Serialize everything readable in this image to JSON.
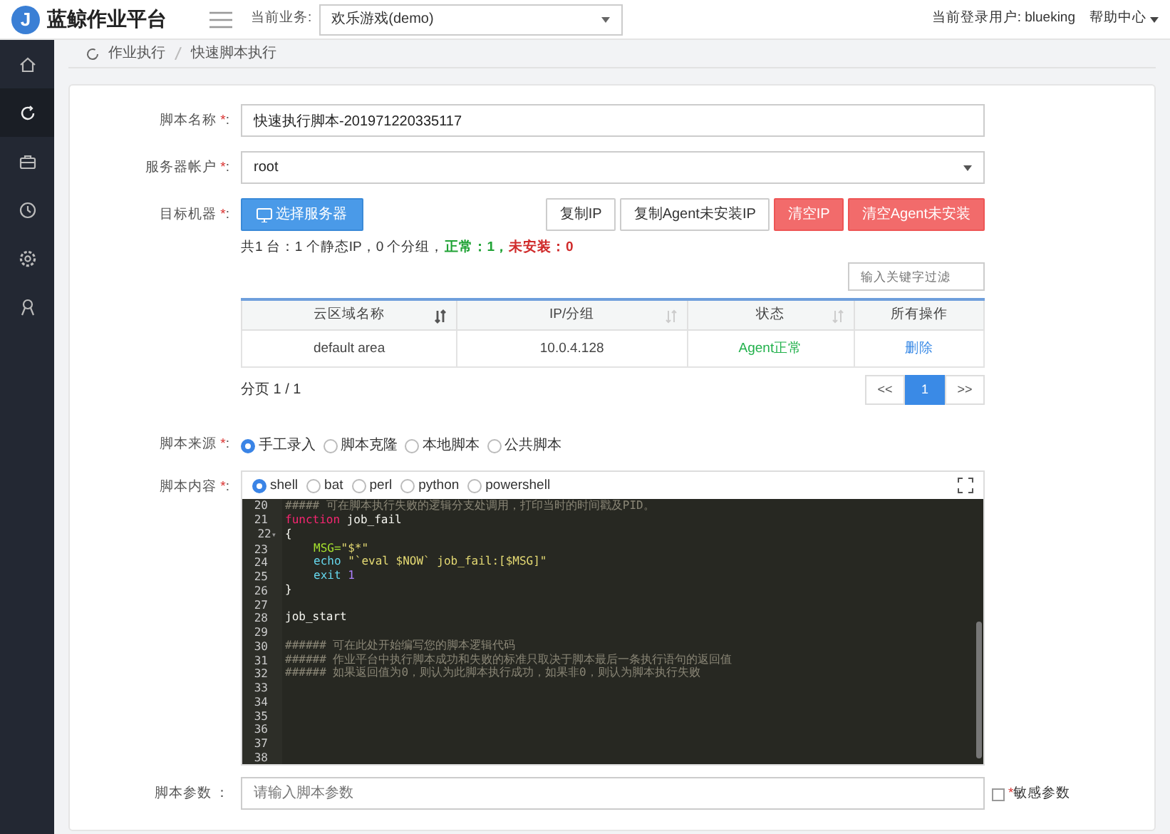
{
  "header": {
    "logo_letter": "J",
    "title": "蓝鲸作业平台",
    "business_label": "当前业务:",
    "business_value": "欢乐游戏(demo)",
    "user": "当前登录用户: blueking",
    "help": "帮助中心"
  },
  "sidebar": {
    "items": [
      {
        "kind": "home",
        "selected": false
      },
      {
        "kind": "refresh",
        "selected": true
      },
      {
        "kind": "briefcase",
        "selected": false
      },
      {
        "kind": "clock",
        "selected": false
      },
      {
        "kind": "gear",
        "selected": false
      },
      {
        "kind": "award",
        "selected": false
      }
    ]
  },
  "breadcrumb": [
    "作业执行",
    "快速脚本执行"
  ],
  "script_name": {
    "label": "脚本名称",
    "mark": "*",
    "suffix": ":",
    "value": "快速执行脚本-201971220335117"
  },
  "account": {
    "label": "服务器帐户",
    "mark": "*",
    "suffix": ":",
    "value": "root"
  },
  "target": {
    "label": "目标机器",
    "mark": "*",
    "suffix": ":",
    "buttons": [
      {
        "kind": "primary",
        "label": "选择服务器"
      },
      {
        "kind": "default",
        "label": "复制IP"
      },
      {
        "kind": "default",
        "label": "复制Agent未安装IP"
      },
      {
        "kind": "danger",
        "label": "清空IP"
      },
      {
        "kind": "danger",
        "label": "清空Agent未安装"
      }
    ],
    "summary": [
      {
        "color": "#333333",
        "text": "共1 台：1 个静态IP，0 个分组，"
      },
      {
        "color": "#21a336",
        "text": "**正常：1，**"
      },
      {
        "color": "#d02b2b",
        "text": "**未安装：0**"
      }
    ],
    "filter_placeholder": "输入关键字过滤",
    "columns": [
      {
        "label": "云区域名称",
        "sortable": true,
        "sort_active": true
      },
      {
        "label": "IP/分组",
        "sortable": true,
        "sort_active": false
      },
      {
        "label": "状态",
        "sortable": true,
        "sort_active": false
      },
      {
        "label": "所有操作",
        "sortable": false
      }
    ],
    "rows": [
      {
        "cloud_area": "default area",
        "ip": "10.0.4.128",
        "status": "Agent正常",
        "status_ok": true,
        "action": "删除"
      }
    ],
    "page_info": "分页 1 / 1",
    "pages": [
      {
        "label": "<<",
        "selected": false
      },
      {
        "label": "1",
        "selected": true
      },
      {
        "label": ">>",
        "selected": false
      }
    ]
  },
  "source": {
    "label": "脚本来源",
    "mark": "*",
    "suffix": ":",
    "options": [
      {
        "label": "手工录入",
        "selected": true
      },
      {
        "label": "脚本克隆",
        "selected": false
      },
      {
        "label": "本地脚本",
        "selected": false
      },
      {
        "label": "公共脚本",
        "selected": false
      }
    ]
  },
  "content": {
    "label": "脚本内容",
    "mark": "*",
    "suffix": ":",
    "languages": [
      {
        "label": "shell",
        "selected": true
      },
      {
        "label": "bat",
        "selected": false
      },
      {
        "label": "perl",
        "selected": false
      },
      {
        "label": "python",
        "selected": false
      },
      {
        "label": "powershell",
        "selected": false
      }
    ],
    "lines": [
      {
        "number": "20",
        "tokens": [
          {
            "kind": "comment",
            "text": "##### 可在脚本执行失败的逻辑分支处调用，打印当时的时间戳及PID。"
          }
        ]
      },
      {
        "number": "21",
        "tokens": [
          {
            "kind": "keyword",
            "text": "function"
          },
          {
            "kind": "plain",
            "text": "job_fail"
          }
        ]
      },
      {
        "number": "22",
        "gutter_mark": "▾",
        "tokens": [
          {
            "kind": "plain",
            "text": "{"
          }
        ]
      },
      {
        "number": "23",
        "indented": true,
        "tokens": [
          {
            "kind": "variable",
            "text": "MSG="
          },
          {
            "kind": "string",
            "text": "\"$*\""
          }
        ]
      },
      {
        "number": "24",
        "indented": true,
        "tokens": [
          {
            "kind": "builtin",
            "text": "echo"
          },
          {
            "kind": "string",
            "text": "\"`eval $NOW` job_fail:[$MSG]\""
          }
        ]
      },
      {
        "number": "25",
        "indented": true,
        "tokens": [
          {
            "kind": "builtin",
            "text": "exit"
          },
          {
            "kind": "number",
            "text": "1"
          }
        ]
      },
      {
        "number": "26",
        "tokens": [
          {
            "kind": "plain",
            "text": "}"
          }
        ]
      },
      {
        "number": "27"
      },
      {
        "number": "28",
        "tokens": [
          {
            "kind": "plain",
            "text": "job_start"
          }
        ]
      },
      {
        "number": "29"
      },
      {
        "number": "30",
        "tokens": [
          {
            "kind": "comment",
            "text": "###### 可在此处开始编写您的脚本逻辑代码"
          }
        ]
      },
      {
        "number": "31",
        "tokens": [
          {
            "kind": "comment",
            "text": "###### 作业平台中执行脚本成功和失败的标准只取决于脚本最后一条执行语句的返回值"
          }
        ]
      },
      {
        "number": "32",
        "tokens": [
          {
            "kind": "comment",
            "text": "###### 如果返回值为0，则认为此脚本执行成功，如果非0，则认为脚本执行失败"
          }
        ]
      },
      {
        "number": "33"
      },
      {
        "number": "34"
      },
      {
        "number": "35"
      },
      {
        "number": "36"
      },
      {
        "number": "37"
      },
      {
        "number": "38"
      }
    ]
  },
  "params": {
    "label": "脚本参数",
    "suffix": "：",
    "placeholder": "请输入脚本参数",
    "sensitive": {
      "checked": false,
      "mark": "*",
      "label": "敏感参数"
    }
  }
}
